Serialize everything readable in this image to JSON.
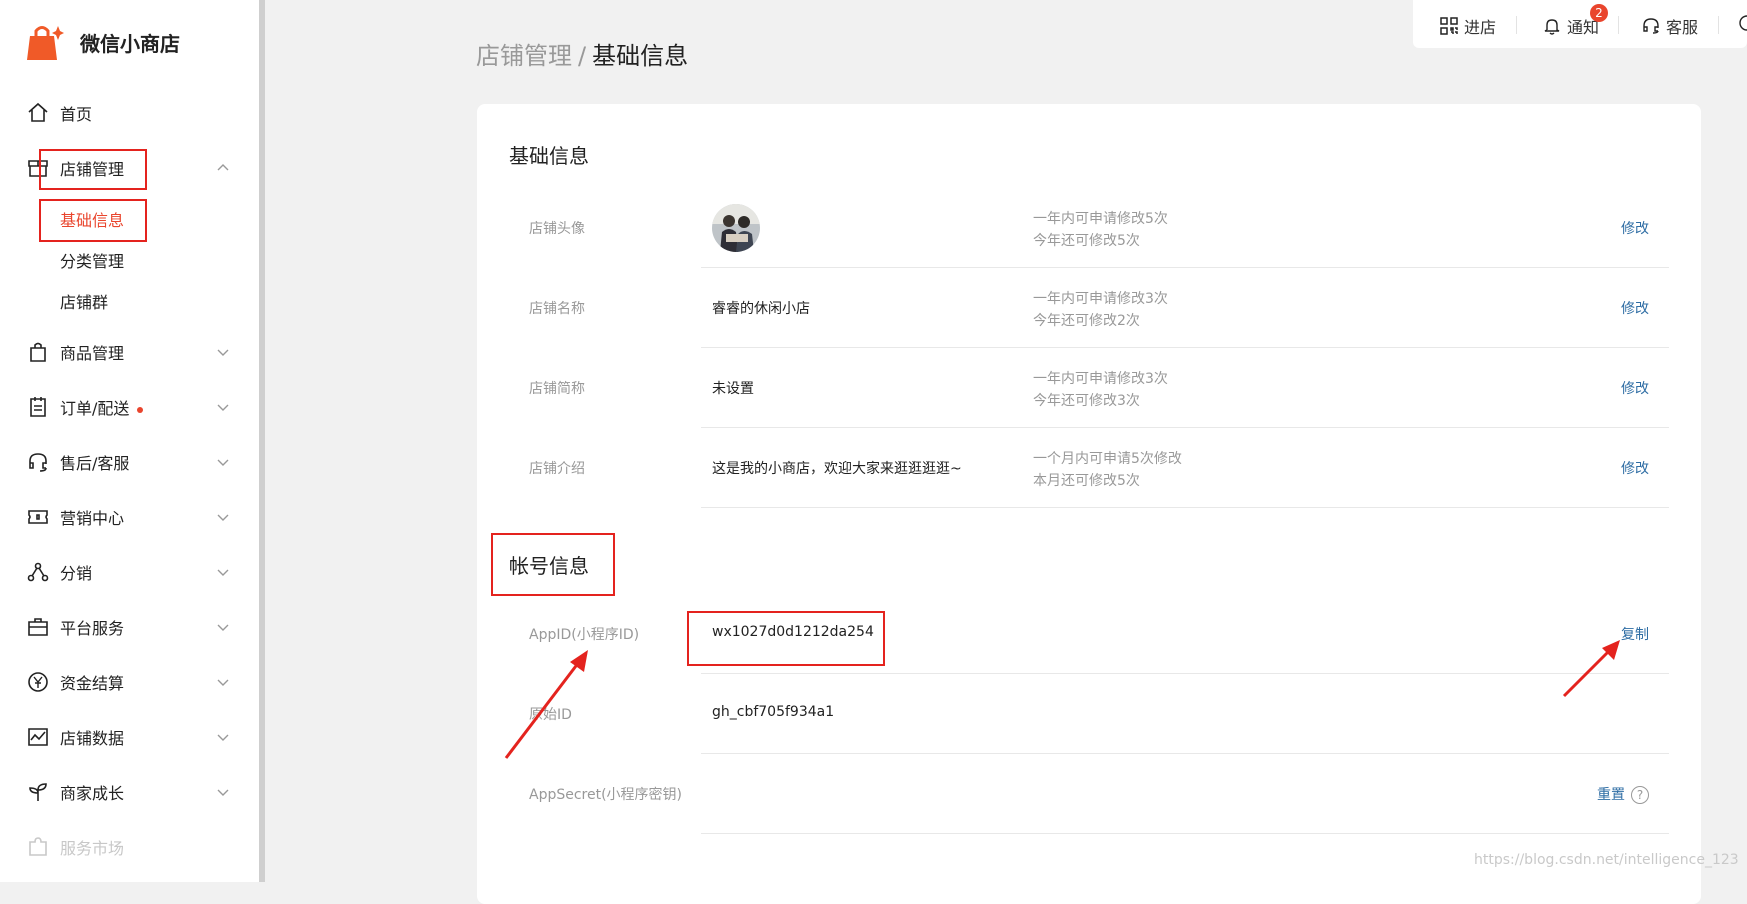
{
  "brand": {
    "name": "微信小商店"
  },
  "sidebar": {
    "items": [
      {
        "label": "首页",
        "icon": "home-icon"
      },
      {
        "label": "店铺管理",
        "icon": "store-icon"
      },
      {
        "label": "商品管理",
        "icon": "bag-icon"
      },
      {
        "label": "订单/配送",
        "icon": "order-icon"
      },
      {
        "label": "售后/客服",
        "icon": "headset-icon"
      },
      {
        "label": "营销中心",
        "icon": "ticket-icon"
      },
      {
        "label": "分销",
        "icon": "share-icon"
      },
      {
        "label": "平台服务",
        "icon": "briefcase-icon"
      },
      {
        "label": "资金结算",
        "icon": "yuan-icon"
      },
      {
        "label": "店铺数据",
        "icon": "chart-icon"
      },
      {
        "label": "商家成长",
        "icon": "sprout-icon"
      },
      {
        "label": "服务市场",
        "icon": "puzzle-icon"
      }
    ],
    "sub_items": [
      "基础信息",
      "分类管理",
      "店铺群"
    ]
  },
  "topbar": {
    "enter_store": "进店",
    "notify": "通知",
    "notify_count": "2",
    "service": "客服"
  },
  "breadcrumb": {
    "parent": "店铺管理",
    "separator": "/",
    "current": "基础信息"
  },
  "basic": {
    "title": "基础信息",
    "rows": [
      {
        "label": "店铺头像",
        "value": "",
        "note1": "一年内可申请修改5次",
        "note2": "今年还可修改5次",
        "action": "修改"
      },
      {
        "label": "店铺名称",
        "value": "睿睿的休闲小店",
        "note1": "一年内可申请修改3次",
        "note2": "今年还可修改2次",
        "action": "修改"
      },
      {
        "label": "店铺简称",
        "value": "未设置",
        "note1": "一年内可申请修改3次",
        "note2": "今年还可修改3次",
        "action": "修改"
      },
      {
        "label": "店铺介绍",
        "value": "这是我的小商店，欢迎大家来逛逛逛逛~",
        "note1": "一个月内可申请5次修改",
        "note2": "本月还可修改5次",
        "action": "修改"
      }
    ]
  },
  "account": {
    "title": "帐号信息",
    "rows": [
      {
        "label": "AppID(小程序ID)",
        "value": "wx1027d0d1212da254",
        "action": "复制"
      },
      {
        "label": "原始ID",
        "value": "gh_cbf705f934a1",
        "action": ""
      },
      {
        "label": "AppSecret(小程序密钥)",
        "value": "",
        "action": "重置",
        "help": "?"
      }
    ]
  },
  "watermark": "https://blog.csdn.net/intelligence_123",
  "colors": {
    "accent": "#e9452d",
    "link": "#2e6da4",
    "annotation": "#e4231e"
  }
}
